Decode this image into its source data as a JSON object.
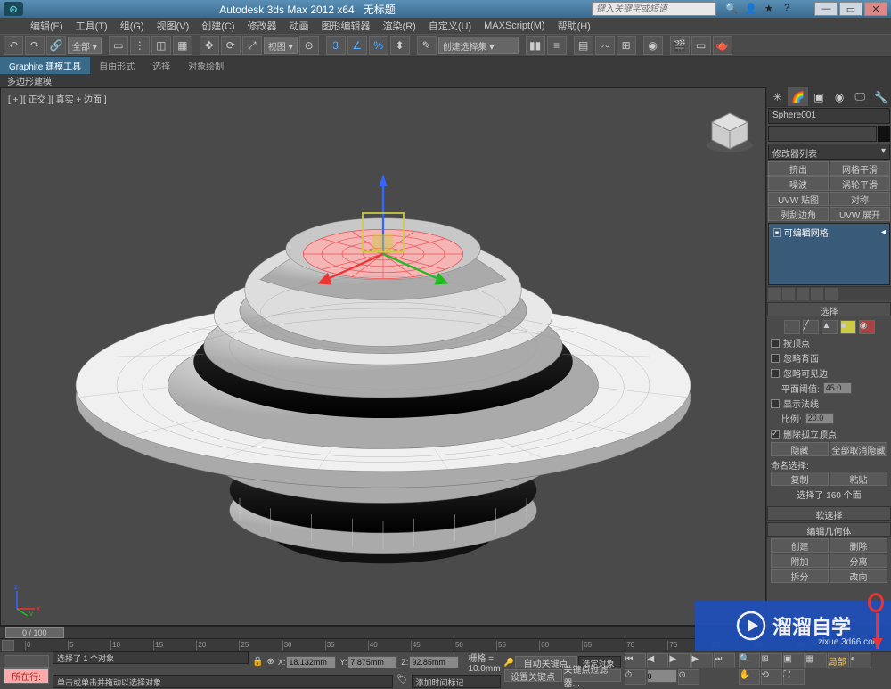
{
  "app": {
    "title": "Autodesk 3ds Max 2012 x64",
    "doc": "无标题"
  },
  "search": {
    "placeholder": "键入关键字或短语"
  },
  "menu": [
    "编辑(E)",
    "工具(T)",
    "组(G)",
    "视图(V)",
    "创建(C)",
    "修改器",
    "动画",
    "图形编辑器",
    "渲染(R)",
    "自定义(U)",
    "MAXScript(M)",
    "帮助(H)"
  ],
  "toolbar": {
    "set_dropdown": "全部 ▾",
    "view_dropdown": "视图 ▾",
    "create_sel_dropdown": "创建选择集 ▾"
  },
  "ribbon": {
    "tabs": [
      "Graphite 建模工具",
      "自由形式",
      "选择",
      "对象绘制"
    ],
    "sub": "多边形建模"
  },
  "viewport": {
    "label": "[ + ][ 正交 ][ 真实 + 边面 ]"
  },
  "panel": {
    "object_name": "Sphere001",
    "modifier_list": "修改器列表",
    "quick_mods": [
      "挤出",
      "网格平滑",
      "噪波",
      "涡轮平滑",
      "UVW 贴图",
      "对称",
      "剥刮边角",
      "UVW 展开"
    ],
    "stack_item": "可编辑网格",
    "rollouts": {
      "selection": {
        "title": "选择",
        "by_vertex": "按顶点",
        "ignore_backfacing": "忽略背面",
        "ignore_visible": "忽略可见边",
        "planar_thresh_label": "平面阈值:",
        "planar_thresh": "45.0",
        "show_normals": "显示法线",
        "scale_label": "比例:",
        "scale": "20.0",
        "delete_iso": "删除孤立顶点",
        "hide": "隐藏",
        "unhide_all": "全部取消隐藏",
        "named_sel": "命名选择:",
        "copy": "复制",
        "paste": "粘贴",
        "status": "选择了 160 个面"
      },
      "soft": {
        "title": "软选择"
      },
      "edit_geo": {
        "title": "编辑几何体",
        "create": "创建",
        "delete": "删除",
        "attach": "附加",
        "detach": "分离",
        "split": "拆分",
        "turn": "改向"
      }
    }
  },
  "timeline": {
    "range": "0 / 100"
  },
  "status": {
    "current": "所在行:",
    "sel_count": "选择了 1 个对象",
    "hint": "单击或单击并拖动以选择对象",
    "add_time_tag": "添加时间标记",
    "x": "18.132mm",
    "y": "7.875mm",
    "z": "92.85mm",
    "grid": "栅格 = 10.0mm",
    "autokey": "自动关键点",
    "selok": "选定对象",
    "setkey": "设置关键点",
    "keyfilter": "关键点过滤器..."
  },
  "watermark": {
    "brand": "溜溜自学",
    "url": "zixue.3d66.com"
  }
}
